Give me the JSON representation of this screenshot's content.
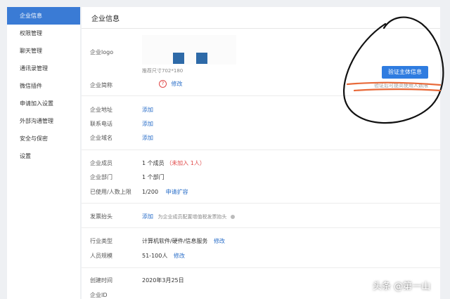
{
  "sidebar": {
    "items": [
      {
        "label": "企业信息",
        "active": true
      },
      {
        "label": "权限管理"
      },
      {
        "label": "聊天管理"
      },
      {
        "label": "通讯录管理"
      },
      {
        "label": "微信插件"
      },
      {
        "label": "申请加入设置"
      },
      {
        "label": "外部沟通管理"
      },
      {
        "label": "安全与保密"
      },
      {
        "label": "设置"
      }
    ]
  },
  "main": {
    "title": "企业信息",
    "logo_label": "企业logo",
    "logo_hint": "推荐尺寸702*180",
    "short_name_label": "企业简称",
    "short_name_edit": "修改",
    "verify_button": "验证主体信息",
    "verify_hint": "验证后可提高使用人数限",
    "address_label": "企业地址",
    "address_action": "添加",
    "phone_label": "联系电话",
    "phone_action": "添加",
    "domain_label": "企业域名",
    "domain_action": "添加",
    "members_label": "企业成员",
    "members_value": "1 个成员",
    "members_note": "（未加入 1人）",
    "depts_label": "企业部门",
    "depts_value": "1 个部门",
    "limit_label": "已使用/人数上限",
    "limit_value": "1/200",
    "limit_action": "申请扩容",
    "invoice_label": "发票抬头",
    "invoice_action": "添加",
    "invoice_hint": "为企业成员配置增值税发票抬头",
    "industry_label": "行业类型",
    "industry_value": "计算机软件/硬件/信息服务",
    "industry_edit": "修改",
    "size_label": "人员规模",
    "size_value": "51-100人",
    "size_edit": "修改",
    "created_label": "创建时间",
    "created_value": "2020年3月25日",
    "corp_id_label": "企业ID"
  },
  "watermark": "头条 @第一山",
  "colors": {
    "accent": "#3a7bd5",
    "link": "#2b6fc9",
    "warn": "#e04848"
  }
}
